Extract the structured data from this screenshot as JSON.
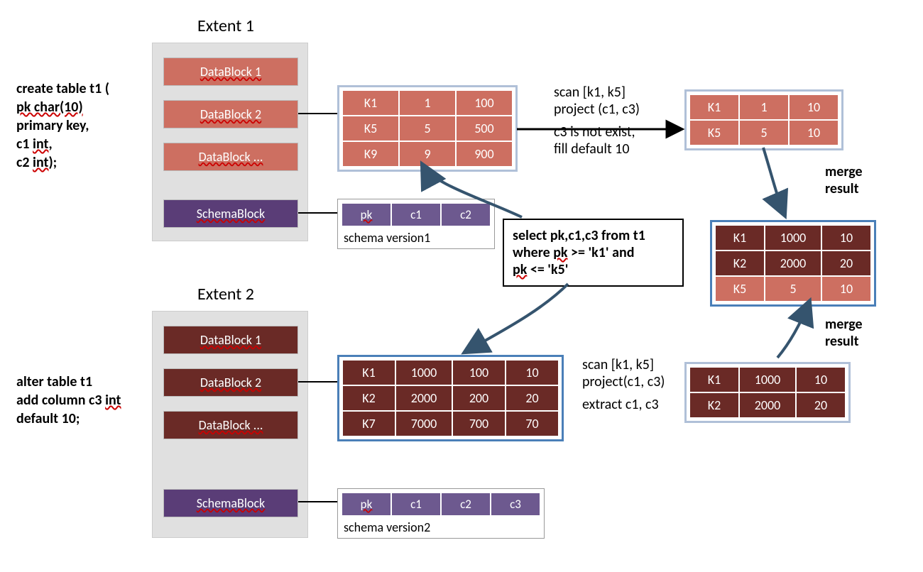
{
  "extent1": {
    "title": "Extent 1",
    "blocks": [
      "DataBlock 1",
      "DataBlock 2",
      "DataBlock ...",
      "SchemaBlock"
    ]
  },
  "extent2": {
    "title": "Extent 2",
    "blocks": [
      "DataBlock 1",
      "DataBlock 2",
      "DataBlock ...",
      "SchemaBlock"
    ]
  },
  "sql_create": {
    "l1": "create table t1 (",
    "l2": "pk char(10)",
    "l2b": "primary key,",
    "l3": "c1 int,",
    "l4": "c2 int);"
  },
  "sql_alter": {
    "l1": "alter table t1",
    "l2": "add column c3 int",
    "l3": "default 10;"
  },
  "table1": {
    "rows": [
      [
        "K1",
        "1",
        "100"
      ],
      [
        "K5",
        "5",
        "500"
      ],
      [
        "K9",
        "9",
        "900"
      ]
    ]
  },
  "schema1": {
    "cols": [
      "pk",
      "c1",
      "c2"
    ],
    "caption": "schema version1"
  },
  "scan1": {
    "l1": "scan [k1, k5]",
    "l2": "project (c1, c3)",
    "l3": "c3 is not exist,",
    "l4": "fill default 10"
  },
  "result1": {
    "rows": [
      [
        "K1",
        "1",
        "10"
      ],
      [
        "K5",
        "5",
        "10"
      ]
    ]
  },
  "merged": {
    "rows": [
      [
        "K1",
        "1000",
        "10"
      ],
      [
        "K2",
        "2000",
        "20"
      ],
      [
        "K5",
        "5",
        "10"
      ]
    ]
  },
  "merge_label": "merge\nresult",
  "query_box": {
    "l1": "select pk,c1,c3 from t1",
    "l2": "where pk >= 'k1' and",
    "l3": "pk <= 'k5'"
  },
  "table2": {
    "rows": [
      [
        "K1",
        "1000",
        "100",
        "10"
      ],
      [
        "K2",
        "2000",
        "200",
        "20"
      ],
      [
        "K7",
        "7000",
        "700",
        "70"
      ]
    ]
  },
  "schema2": {
    "cols": [
      "pk",
      "c1",
      "c2",
      "c3"
    ],
    "caption": "schema version2"
  },
  "scan2": {
    "l1": "scan [k1, k5]",
    "l2": "project(c1, c3)",
    "l3": "extract c1, c3"
  },
  "result2": {
    "rows": [
      [
        "K1",
        "1000",
        "10"
      ],
      [
        "K2",
        "2000",
        "20"
      ]
    ]
  }
}
